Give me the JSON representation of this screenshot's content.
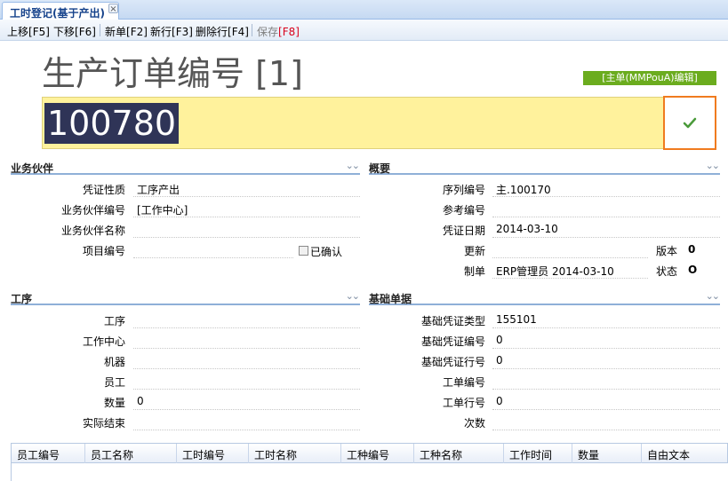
{
  "tab": {
    "title": "工时登记(基于产出)",
    "close_icon": "close-icon"
  },
  "toolbar": {
    "move_up": "上移",
    "move_up_key": "[F5]",
    "move_down": "下移",
    "move_down_key": "[F6]",
    "new_doc": "新单",
    "new_doc_key": "[F2]",
    "new_row": "新行",
    "new_row_key": "[F3]",
    "delete_row": "删除行",
    "delete_row_key": "[F4]",
    "save": "保存",
    "save_key": "[F8]"
  },
  "header": {
    "title": "生产订单编号 [1]",
    "mode_badge": "[主单(MMPouA)编辑]",
    "order_number": "100780",
    "confirm_icon": "checkmark-icon"
  },
  "partner": {
    "title": "业务伙伴",
    "fields": [
      {
        "label": "凭证性质",
        "value": "工序产出"
      },
      {
        "label": "业务伙伴编号",
        "value": "[工作中心]"
      },
      {
        "label": "业务伙伴名称",
        "value": ""
      },
      {
        "label": "项目编号",
        "value": ""
      }
    ],
    "confirmed_label": "已确认"
  },
  "summary": {
    "title": "概要",
    "fields": [
      {
        "label": "序列编号",
        "value": "主.100170"
      },
      {
        "label": "参考编号",
        "value": ""
      },
      {
        "label": "凭证日期",
        "value": "2014-03-10"
      },
      {
        "label": "更新",
        "value": ""
      },
      {
        "label": "制单",
        "value": "ERP管理员 2014-03-10"
      }
    ],
    "version_label": "版本",
    "version_value": "0",
    "status_label": "状态",
    "status_value": "O"
  },
  "process": {
    "title": "工序",
    "fields": [
      {
        "label": "工序",
        "value": ""
      },
      {
        "label": "工作中心",
        "value": ""
      },
      {
        "label": "机器",
        "value": ""
      },
      {
        "label": "员工",
        "value": ""
      },
      {
        "label": "数量",
        "value": "0"
      },
      {
        "label": "实际结束",
        "value": ""
      }
    ]
  },
  "base_doc": {
    "title": "基础单据",
    "fields": [
      {
        "label": "基础凭证类型",
        "value": "155101"
      },
      {
        "label": "基础凭证编号",
        "value": "0"
      },
      {
        "label": "基础凭证行号",
        "value": "0"
      },
      {
        "label": "工单编号",
        "value": ""
      },
      {
        "label": "工单行号",
        "value": "0"
      },
      {
        "label": "次数",
        "value": ""
      }
    ]
  },
  "grid": {
    "columns": [
      "员工编号",
      "员工名称",
      "工时编号",
      "工时名称",
      "工种编号",
      "工种名称",
      "工作时间",
      "数量",
      "自由文本"
    ]
  },
  "colors": {
    "accent_orange": "#f07b1f",
    "badge_green": "#6bac1e",
    "highlight_yellow": "#fff29c",
    "section_line": "#8fb0d8"
  }
}
